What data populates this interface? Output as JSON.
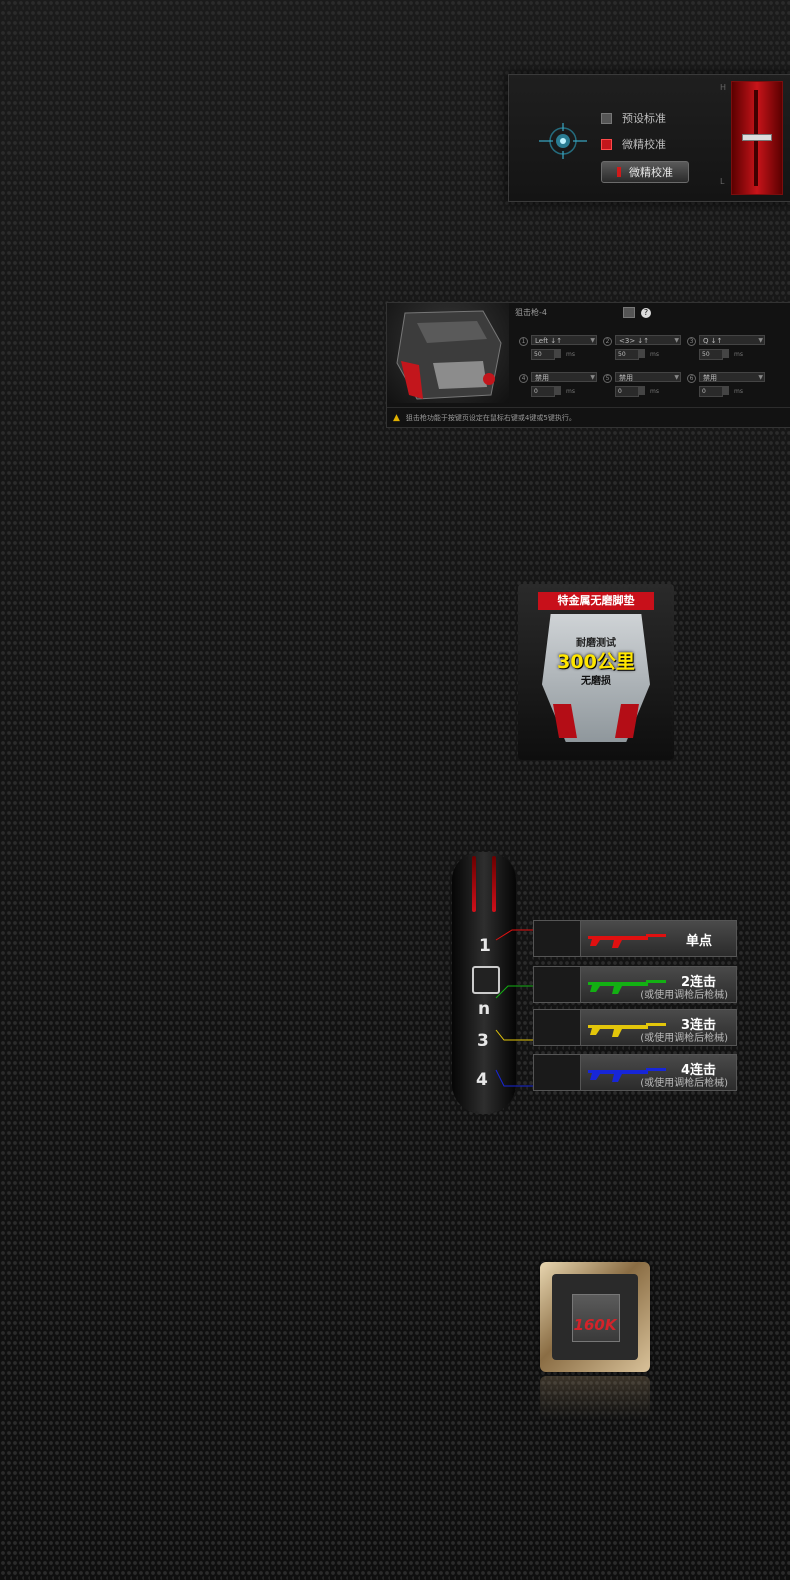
{
  "calibration": {
    "option_preset": "预设标准",
    "option_fine": "微精校准",
    "button_fine": "微精校准",
    "slider_high": "H",
    "slider_low": "L"
  },
  "keyconfig": {
    "header": "狙击枪-4",
    "help": "?",
    "slots": [
      {
        "num": "1",
        "key": "Left ↓↑",
        "value": "50",
        "unit": "ms"
      },
      {
        "num": "2",
        "key": "<3> ↓↑",
        "value": "50",
        "unit": "ms"
      },
      {
        "num": "3",
        "key": "Q ↓↑",
        "value": "50",
        "unit": "ms"
      },
      {
        "num": "4",
        "key": "禁用",
        "value": "0",
        "unit": "ms"
      },
      {
        "num": "5",
        "key": "禁用",
        "value": "0",
        "unit": "ms"
      },
      {
        "num": "6",
        "key": "禁用",
        "value": "0",
        "unit": "ms"
      }
    ],
    "note": "狙击枪功能于按键页设定在鼠标右键或4键或5键执行。"
  },
  "feet": {
    "banner": "特金属无磨脚垫",
    "line1": "耐磨测试",
    "line2": "300公里",
    "line3": "无磨损"
  },
  "modes": {
    "nums": [
      "1",
      "n",
      "3",
      "4"
    ],
    "rows": [
      {
        "title": "单点",
        "sub": "",
        "color": "#e01010"
      },
      {
        "title": "2连击",
        "sub": "(或使用调枪后枪械)",
        "color": "#13b013"
      },
      {
        "title": "3连击",
        "sub": "(或使用调枪后枪械)",
        "color": "#e3c60a"
      },
      {
        "title": "4连击",
        "sub": "(或使用调枪后枪械)",
        "color": "#1726d8"
      }
    ]
  },
  "chip": {
    "label": "160K"
  }
}
